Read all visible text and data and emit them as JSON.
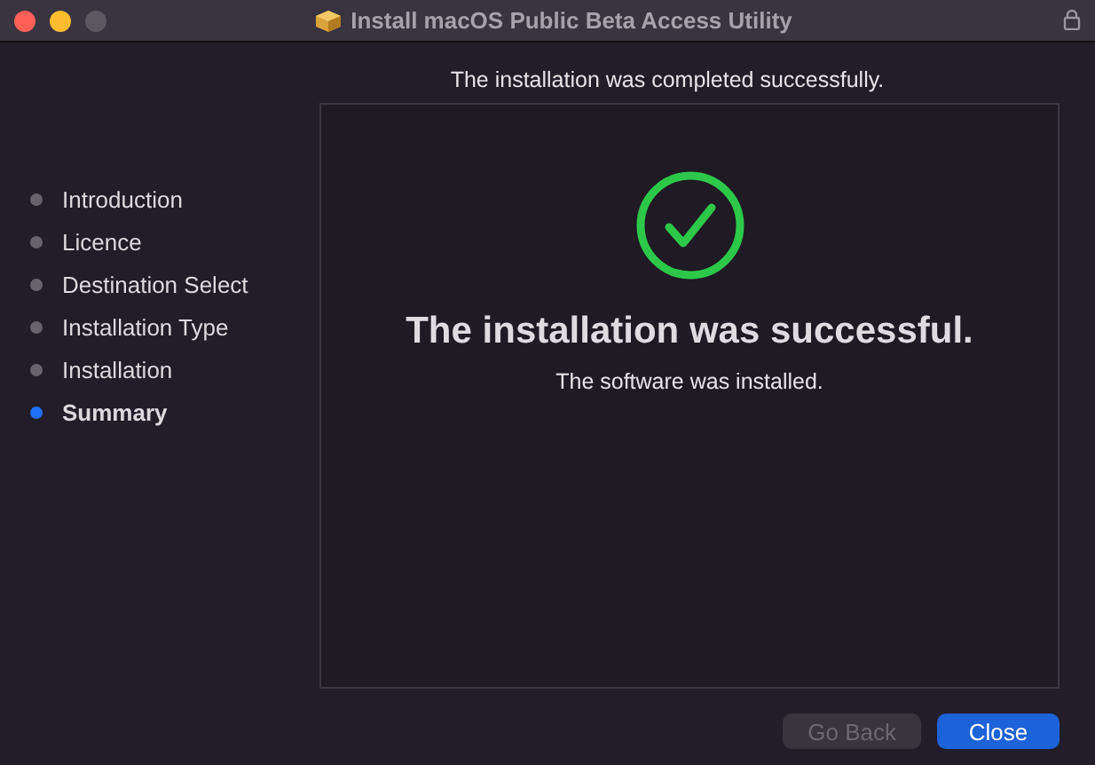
{
  "window": {
    "title": "Install macOS Public Beta Access Utility",
    "locked": true
  },
  "header": "The installation was completed successfully.",
  "steps": [
    {
      "label": "Introduction",
      "selected": false
    },
    {
      "label": "Licence",
      "selected": false
    },
    {
      "label": "Destination Select",
      "selected": false
    },
    {
      "label": "Installation Type",
      "selected": false
    },
    {
      "label": "Installation",
      "selected": false
    },
    {
      "label": "Summary",
      "selected": true
    }
  ],
  "result": {
    "succeeded": true,
    "title": "The installation was successful.",
    "message": "The software was installed."
  },
  "buttons": [
    {
      "label": "Go Back",
      "disabled": true,
      "primary": false
    },
    {
      "label": "Close",
      "disabled": false,
      "primary": true
    }
  ]
}
